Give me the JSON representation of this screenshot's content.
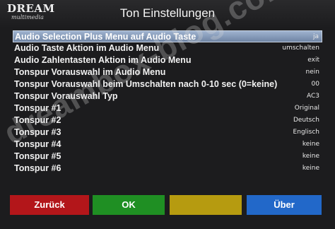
{
  "header": {
    "logo_text": "DREAM",
    "logo_subtext": "multimedia",
    "title": "Ton Einstellungen"
  },
  "settings": [
    {
      "label": "Audio Selection Plus Menu auf Audio Taste",
      "value": "ja"
    },
    {
      "label": "Audio Taste Aktion im Audio Menu",
      "value": "umschalten"
    },
    {
      "label": "Audio Zahlentasten Aktion im Audio Menu",
      "value": "exit"
    },
    {
      "label": "Tonspur Vorauswahl im Audio Menu",
      "value": "nein"
    },
    {
      "label": "Tonspur Vorauswahl beim Umschalten nach 0-10 sec (0=keine)",
      "value": "00"
    },
    {
      "label": "Tonspur Vorauswahl Typ",
      "value": "AC3"
    },
    {
      "label": "Tonspur #1",
      "value": "Original"
    },
    {
      "label": "Tonspur #2",
      "value": "Deutsch"
    },
    {
      "label": "Tonspur #3",
      "value": "Englisch"
    },
    {
      "label": "Tonspur #4",
      "value": "keine"
    },
    {
      "label": "Tonspur #5",
      "value": "keine"
    },
    {
      "label": "Tonspur #6",
      "value": "keine"
    }
  ],
  "selected_index": 0,
  "buttons": {
    "red_label": "Zurück",
    "green_label": "OK",
    "yellow_label": "",
    "blue_label": "Über"
  },
  "watermark": "dreambox-blog.com",
  "colors": {
    "red": "#b3161a",
    "green": "#1f8f23",
    "yellow": "#b69b10",
    "blue": "#2268c9",
    "selection": "#8da2c0"
  }
}
